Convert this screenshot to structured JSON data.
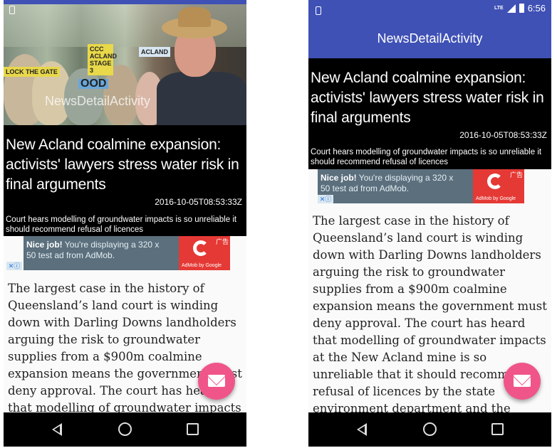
{
  "phone1": {
    "toolbar_title": "NewsDetailActivity",
    "hero_signs": [
      "LOCK THE GATE",
      "CCC ACLAND STAGE 3",
      "OOD",
      "ACLAND"
    ],
    "article": {
      "title": "New Acland coalmine expansion: activists' lawyers stress water risk in final arguments",
      "date": "2016-10-05T08:53:33Z",
      "description": "Court hears modelling of groundwater impacts is so unreliable it should recommend refusal of licences",
      "body": "The largest case in the history of Queensland’s land court is winding down with Darling Downs landholders arguing the risk to groundwater supplies from a $900m coalmine expansion means the government must deny approval. The court has heard that modelling of groundwater impacts at"
    },
    "ad": {
      "headline": "Nice job!",
      "text": "You're displaying a 320 x 50 test ad from AdMob.",
      "brand": "AdMob by Google",
      "cn_label": "广告",
      "close_label": "✕ⓘ"
    }
  },
  "phone2": {
    "status": {
      "network": "LTE",
      "time": "6:56"
    },
    "toolbar_title": "NewsDetailActivity",
    "article": {
      "title": "New Acland coalmine expansion: activists' lawyers stress water risk in final arguments",
      "date": "2016-10-05T08:53:33Z",
      "description": "Court hears modelling of groundwater impacts is so unreliable it should recommend refusal of licences",
      "body": "The largest case in the history of Queensland’s land court is winding down with Darling Downs landholders arguing the risk to groundwater supplies from a $900m coalmine expansion means the government must deny approval. The court has heard that modelling of groundwater impacts at the New Acland mine is so unreliable that it should recommend refusal of licences by the state environment department and the mining minister."
    },
    "ad": {
      "headline": "Nice job!",
      "text": "You're displaying a 320 x 50 test ad from AdMob.",
      "brand": "AdMob by Google",
      "cn_label": "广告",
      "close_label": "✕ⓘ"
    }
  },
  "icons": {
    "fab": "mail-icon",
    "nav": [
      "back-icon",
      "home-icon",
      "recent-apps-icon"
    ]
  },
  "colors": {
    "primary": "#3f51b5",
    "fab": "#f05589",
    "ad_bg": "#5b6f7d",
    "ad_logo": "#e53935"
  }
}
